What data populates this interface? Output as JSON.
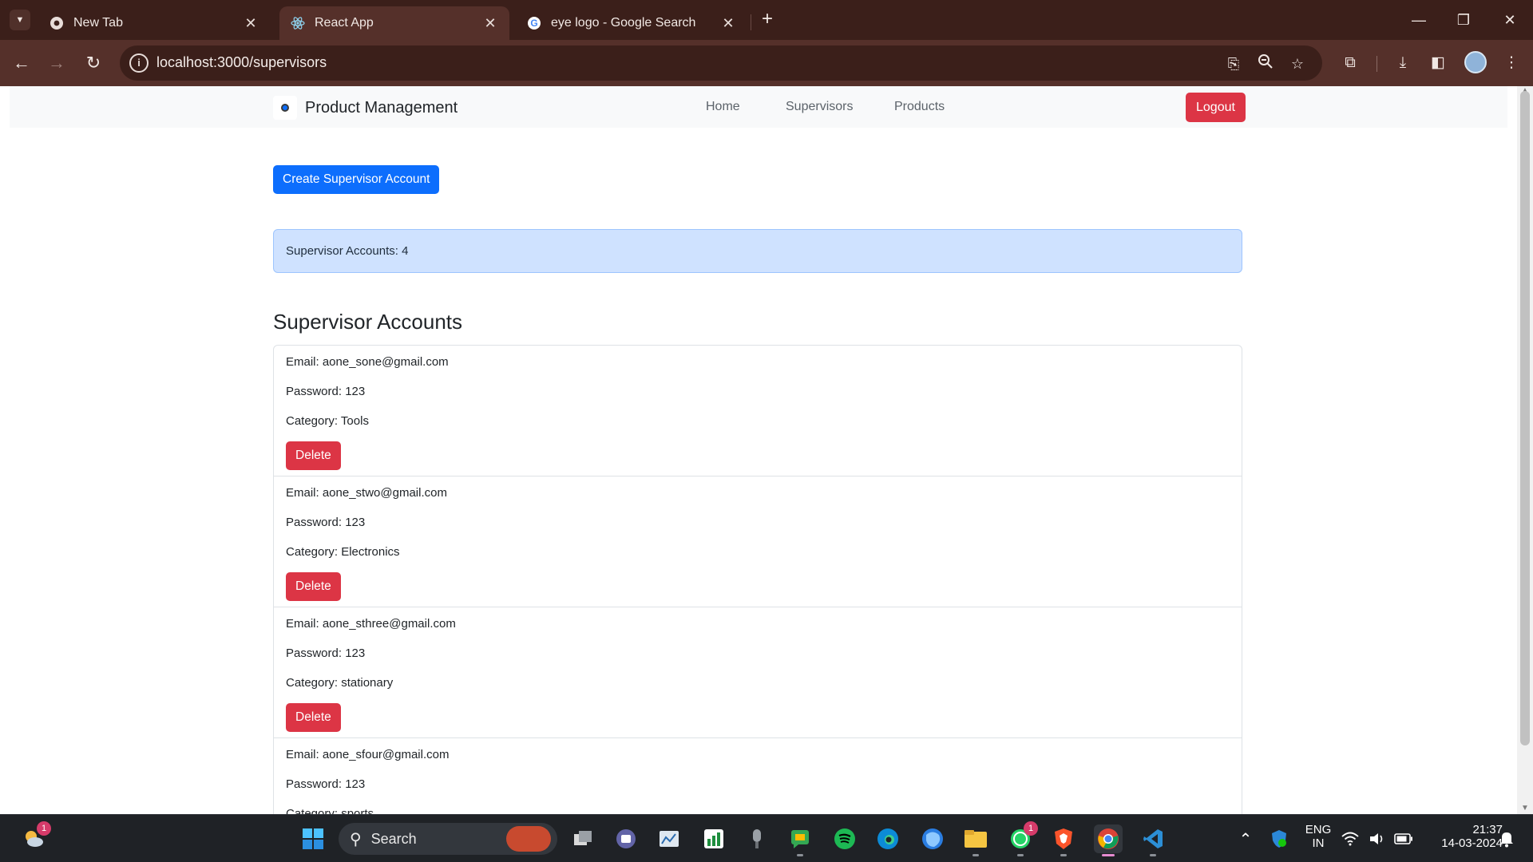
{
  "browser": {
    "tabs": [
      {
        "title": "New Tab",
        "favicon": "chrome-icon",
        "active": false
      },
      {
        "title": "React App",
        "favicon": "react-icon",
        "active": true
      },
      {
        "title": "eye logo - Google Search",
        "favicon": "google-icon",
        "active": false
      }
    ],
    "url": "localhost:3000/supervisors",
    "window_controls": [
      "minimize",
      "restore",
      "close"
    ]
  },
  "app": {
    "brand": "Product Management",
    "nav": [
      {
        "label": "Home"
      },
      {
        "label": "Supervisors"
      },
      {
        "label": "Products"
      }
    ],
    "logout_label": "Logout",
    "create_label": "Create Supervisor Account",
    "count_text": "Supervisor Accounts: 4",
    "section_title": "Supervisor Accounts",
    "delete_label": "Delete",
    "accounts": [
      {
        "email": "Email: aone_sone@gmail.com",
        "password": "Password: 123",
        "category": "Category: Tools"
      },
      {
        "email": "Email: aone_stwo@gmail.com",
        "password": "Password: 123",
        "category": "Category: Electronics"
      },
      {
        "email": "Email: aone_sthree@gmail.com",
        "password": "Password: 123",
        "category": "Category: stationary"
      },
      {
        "email": "Email: aone_sfour@gmail.com",
        "password": "Password: 123",
        "category": "Category: sports"
      }
    ]
  },
  "taskbar": {
    "search_label": "Search",
    "weather_badge": "1",
    "whatsapp_badge": "1",
    "language_line1": "ENG",
    "language_line2": "IN",
    "time": "21:37",
    "date": "14-03-2024"
  },
  "colors": {
    "primary": "#0d6efd",
    "danger": "#dc3545",
    "alert_bg": "#cfe2ff",
    "chrome_frame": "#3b1f1a",
    "chrome_toolbar": "#55302a"
  }
}
